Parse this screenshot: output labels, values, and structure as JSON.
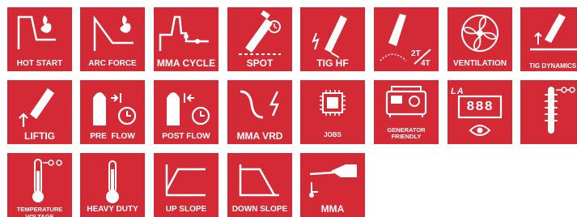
{
  "icons": [
    {
      "label": "HOT START"
    },
    {
      "label": "ARC FORCE"
    },
    {
      "label": "MMA CYCLE"
    },
    {
      "label": "SPOT"
    },
    {
      "label": "TIG HF"
    },
    {
      "label": "2T/4T",
      "t2": "2T",
      "t4": "4T"
    },
    {
      "label": "VENTILATION"
    },
    {
      "label": "TIG DYNAMICS"
    },
    {
      "label": "LIFTIG"
    },
    {
      "label": "PRE  FLOW"
    },
    {
      "label": "POST FLOW"
    },
    {
      "label": "MMA VRD"
    },
    {
      "label": "JOBS"
    },
    {
      "label": "GENERATOR FRIENDLY"
    },
    {
      "label": "888",
      "sub": "LA"
    },
    {
      "label": ""
    },
    {
      "label": "TEMPERATURE VOLTAGE"
    },
    {
      "label": "HEAVY DUTY"
    },
    {
      "label": "UP SLOPE"
    },
    {
      "label": "DOWN SLOPE"
    },
    {
      "label": "MMA"
    }
  ]
}
